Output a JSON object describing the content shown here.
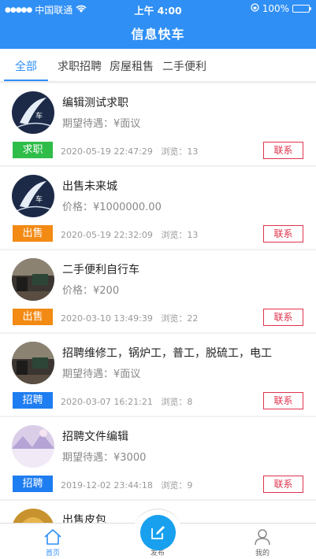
{
  "status_bar": {
    "carrier": "中国联通",
    "time": "上午 4:00",
    "battery": "100%"
  },
  "header": {
    "title": "信息快车"
  },
  "tabs": [
    "全部",
    "求职招聘",
    "房屋租售",
    "二手便利"
  ],
  "contact_label": "联系",
  "colors": {
    "primary": "#2f8ff5",
    "tag_job": "#2ebd48",
    "tag_sell": "#f28a14",
    "tag_recruit": "#1e7df0",
    "contact": "#e0334d"
  },
  "posts": [
    {
      "title": "编辑测试求职",
      "sub": "期望待遇：¥面议",
      "tag": "求职",
      "tag_color": "#2ebd48",
      "date": "2020-05-19 22:47:29",
      "views": "浏览：13",
      "avatar": "car-logo"
    },
    {
      "title": "出售未来城",
      "sub": "价格：¥1000000.00",
      "tag": "出售",
      "tag_color": "#f28a14",
      "date": "2020-05-19 22:32:09",
      "views": "浏览：13",
      "avatar": "car-logo"
    },
    {
      "title": "二手便利自行车",
      "sub": "价格：¥200",
      "tag": "出售",
      "tag_color": "#f28a14",
      "date": "2020-03-10 13:49:39",
      "views": "浏览：22",
      "avatar": "office-photo"
    },
    {
      "title": "招聘维修工，锅炉工，普工，脱硫工，电工",
      "sub": "期望待遇：¥面议",
      "tag": "招聘",
      "tag_color": "#1e7df0",
      "date": "2020-03-07 16:21:21",
      "views": "浏览：8",
      "avatar": "office-photo"
    },
    {
      "title": "招聘文件编辑",
      "sub": "期望待遇：¥3000",
      "tag": "招聘",
      "tag_color": "#1e7df0",
      "date": "2019-12-02 23:44:18",
      "views": "浏览：9",
      "avatar": "pastel-landscape"
    },
    {
      "title": "出售皮包",
      "sub": "",
      "tag": "",
      "tag_color": "#f28a14",
      "date": "",
      "views": "",
      "avatar": "golden-photo"
    }
  ],
  "tabbar": {
    "home": "首页",
    "publish": "发布",
    "mine": "我的"
  }
}
